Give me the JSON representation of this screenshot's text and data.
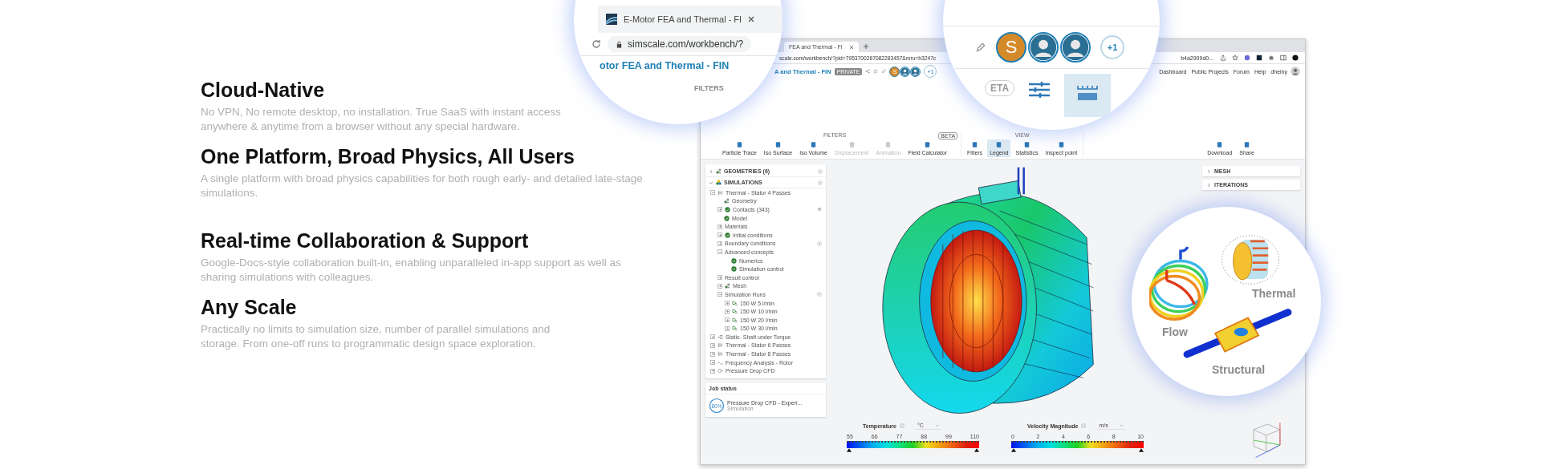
{
  "features": [
    {
      "title": "Cloud-Native",
      "text": "No VPN, No remote desktop, no installation. True SaaS with instant access anywhere & anytime from a browser without any special hardware."
    },
    {
      "title": "One Platform, Broad Physics, All Users",
      "text": "A single platform with broad physics capabilities for both rough early- and detailed late-stage simulations."
    },
    {
      "title": "Real-time Collaboration & Support",
      "text": "Google-Docs-style collaboration built-in, enabling unparalleled in-app support as well as sharing simulations with colleagues."
    },
    {
      "title": "Any Scale",
      "text": "Practically no limits to simulation size, number of parallel simulations and storage. From one-off runs to programmatic design space exploration."
    }
  ],
  "browser": {
    "tab_title": "FEA and Thermal - FI",
    "url_left": "scale.com/workbench/?pid=7953700267082283457&mru=b3247c",
    "url_right": "b4a2909d0..."
  },
  "app_header": {
    "project_title": "A and Thermal - FIN",
    "badge": "PRIVATE",
    "collaborators": [
      {
        "kind": "letter",
        "initial": "S"
      },
      {
        "kind": "photo"
      },
      {
        "kind": "photo"
      }
    ],
    "more": "+1",
    "nav": [
      "Dashboard",
      "Public Projects",
      "Forum",
      "Help"
    ],
    "user": "dheiny"
  },
  "toolbar": {
    "groups": [
      {
        "label": "FILTERS",
        "tools": [
          {
            "label": "Particle Trace",
            "disabled": false,
            "selected": false
          },
          {
            "label": "Iso Surface",
            "disabled": false,
            "selected": false
          },
          {
            "label": "Iso Volume",
            "disabled": false,
            "selected": false
          },
          {
            "label": "Displacement",
            "disabled": true,
            "selected": false
          },
          {
            "label": "Animation",
            "disabled": true,
            "selected": false
          },
          {
            "label": "Field Calculator",
            "badge": "BETA",
            "disabled": false,
            "selected": false
          }
        ]
      },
      {
        "label": "VIEW",
        "tools": [
          {
            "label": "Filters",
            "disabled": false,
            "selected": false
          },
          {
            "label": "Legend",
            "disabled": false,
            "selected": true
          },
          {
            "label": "Statistics",
            "disabled": false,
            "selected": false
          },
          {
            "label": "Inspect point",
            "disabled": false,
            "selected": false
          }
        ]
      },
      {
        "tools": [
          {
            "label": "Download",
            "disabled": false,
            "selected": false
          },
          {
            "label": "Share",
            "disabled": false,
            "selected": false
          }
        ]
      }
    ]
  },
  "tree": {
    "sections": [
      {
        "label": "GEOMETRIES (6)",
        "kind": "geometry",
        "expanded": false
      },
      {
        "label": "SIMULATIONS",
        "kind": "simulation",
        "expanded": true,
        "children": [
          {
            "label": "Thermal - Stator 4 Passes",
            "kind": "thermal",
            "expanded": true,
            "children": [
              {
                "label": "Geometry",
                "kind": "geometry"
              },
              {
                "label": "Contacts (343)",
                "kind": "check",
                "expanded": false,
                "action": {
                  "kind": "filter"
                }
              },
              {
                "label": "Model",
                "kind": "check"
              },
              {
                "label": "Materials",
                "kind": "plain",
                "expanded": false
              },
              {
                "label": "Initial conditions",
                "kind": "check",
                "expanded": false
              },
              {
                "label": "Boundary conditions",
                "kind": "plain",
                "expanded": false,
                "action": {
                  "kind": "add"
                }
              },
              {
                "label": "Advanced concepts",
                "kind": "plain",
                "expanded": true,
                "children": [
                  {
                    "label": "Numerics",
                    "kind": "check"
                  },
                  {
                    "label": "Simulation control",
                    "kind": "check"
                  }
                ]
              },
              {
                "label": "Result control",
                "kind": "plain",
                "expanded": false
              },
              {
                "label": "Mesh",
                "kind": "geometry",
                "expanded": false
              },
              {
                "label": "Simulation Runs",
                "kind": "plain",
                "expanded": true,
                "action": {
                  "kind": "add"
                },
                "children": [
                  {
                    "label": "150 W 5 l/min",
                    "kind": "run",
                    "expanded": false
                  },
                  {
                    "label": "150 W 10 l/min",
                    "kind": "run",
                    "expanded": false
                  },
                  {
                    "label": "150 W 20 l/min",
                    "kind": "run",
                    "expanded": false
                  },
                  {
                    "label": "150 W 30 l/min",
                    "kind": "run",
                    "expanded": false
                  }
                ]
              }
            ]
          },
          {
            "label": "Static- Shaft under Torque",
            "kind": "static",
            "expanded": false
          },
          {
            "label": "Thermal - Stator 6 Passes",
            "kind": "thermal",
            "expanded": false
          },
          {
            "label": "Thermal - Stator 8 Passes",
            "kind": "thermal",
            "expanded": false
          },
          {
            "label": "Frequency Analysis - Rotor",
            "kind": "frequency",
            "expanded": false
          },
          {
            "label": "Pressure Drop CFD",
            "kind": "cfd",
            "expanded": false
          }
        ]
      }
    ]
  },
  "job_status": {
    "title": "Job status",
    "progress": "80%",
    "name": "Pressure Drop CFD - Experi...",
    "type": "Simulation"
  },
  "right_panels": [
    {
      "label": "MESH",
      "expanded": false
    },
    {
      "label": "ITERATIONS",
      "expanded": false
    }
  ],
  "legends": [
    {
      "name": "Temperature",
      "unit": "°C",
      "ticks": [
        "55",
        "66",
        "77",
        "88",
        "99",
        "110"
      ]
    },
    {
      "name": "Velocity Magnitude",
      "unit": "m/s",
      "ticks": [
        "0",
        "2",
        "4",
        "6",
        "8",
        "10"
      ]
    }
  ],
  "lens_tab": {
    "tab_title": "E-Motor FEA and Thermal - FI",
    "url": "simscale.com/workbench/?",
    "project_title": "otor FEA and Thermal - FIN",
    "section": "FILTERS"
  },
  "lens_collab": {
    "avatars": [
      {
        "kind": "letter",
        "initial": "S"
      },
      {
        "kind": "photo"
      },
      {
        "kind": "photo"
      }
    ],
    "more": "+1",
    "badge": "ETA"
  },
  "lens_physics": {
    "labels": [
      "Flow",
      "Thermal",
      "Structural"
    ]
  }
}
